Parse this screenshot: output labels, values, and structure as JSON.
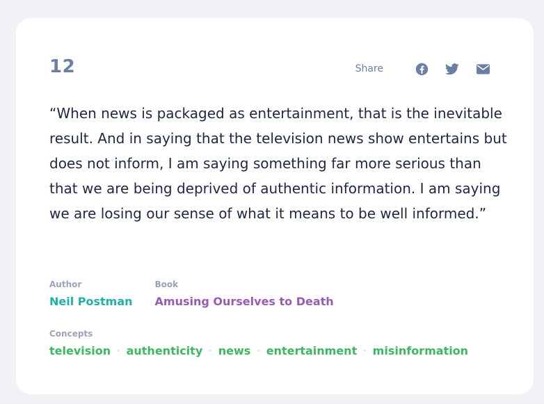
{
  "quote": {
    "number": "12",
    "text": "“When news is packaged as entertainment, that is the inevitable result. And in saying that the television news show entertains but does not inform, I am saying something far more serious than that we are being deprived of authentic information. I am saying we are losing our sense of what it means to be well informed.”"
  },
  "share": {
    "label": "Share",
    "buttons": [
      {
        "icon": "facebook-icon"
      },
      {
        "icon": "twitter-icon"
      },
      {
        "icon": "email-icon"
      }
    ]
  },
  "meta": {
    "author_label": "Author",
    "author": "Neil Postman",
    "book_label": "Book",
    "book": "Amusing Ourselves to Death"
  },
  "concepts": {
    "label": "Concepts",
    "items": [
      "television",
      "authenticity",
      "news",
      "entertainment",
      "misinformation"
    ],
    "separator": "·"
  },
  "colors": {
    "background": "#f1f2f6",
    "card": "#ffffff",
    "number": "#6b7fa5",
    "quote_text": "#1d2742",
    "author": "#1fb1a5",
    "book": "#9b59b6",
    "concept": "#3cb861"
  }
}
